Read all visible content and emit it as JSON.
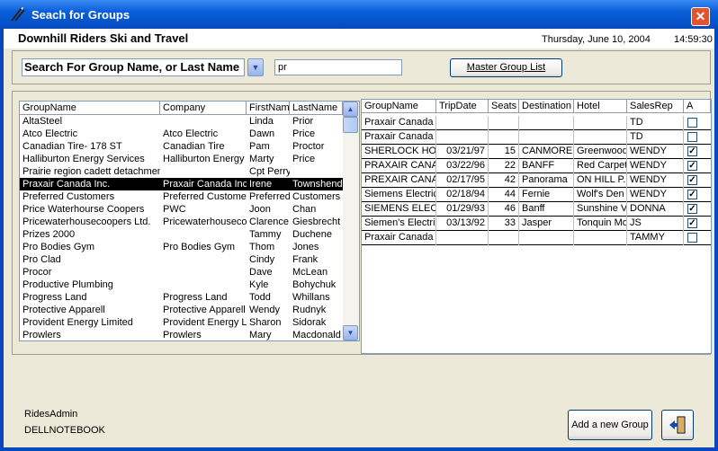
{
  "window": {
    "title": "Seach for Groups",
    "close_label": "✕"
  },
  "header": {
    "company": "Downhill Riders Ski and Travel",
    "date": "Thursday, June 10, 2004",
    "time": "14:59:30"
  },
  "search": {
    "field_label": "Search For Group Name, or Last Name",
    "value": "pr",
    "master_button": "Master Group List"
  },
  "left_grid": {
    "columns": [
      "GroupName",
      "Company",
      "FirstName",
      "LastName"
    ],
    "selected_index": 5,
    "rows": [
      [
        "AltaSteel",
        "",
        "Linda",
        "Prior"
      ],
      [
        "Atco Electric",
        "Atco Electric",
        "Dawn",
        "Price"
      ],
      [
        "Canadian Tire- 178 ST",
        "Canadian Tire",
        "Pam",
        "Proctor"
      ],
      [
        "Halliburton Energy Services",
        "Halliburton Energy S",
        "Marty",
        "Price"
      ],
      [
        "Prairie region cadett detachmen",
        "",
        "Cpt Perry",
        ""
      ],
      [
        "Praxair Canada Inc.",
        "Praxair Canada Inc",
        "Irene",
        "Townshend"
      ],
      [
        "Preferred Customers",
        "Preferred Customer",
        "Preferred",
        "Customers"
      ],
      [
        "Price Waterhourse Coopers",
        "PWC",
        "Joon",
        "Chan"
      ],
      [
        "Pricewaterhousecoopers Ltd.",
        "Pricewaterhouseco",
        "Clarence",
        "Giesbrecht"
      ],
      [
        "Prizes 2000",
        "",
        "Tammy",
        "Duchene"
      ],
      [
        "Pro Bodies Gym",
        "Pro Bodies Gym",
        "Thom",
        "Jones"
      ],
      [
        "Pro Clad",
        "",
        "Cindy",
        "Frank"
      ],
      [
        "Procor",
        "",
        "Dave",
        "McLean"
      ],
      [
        "Productive Plumbing",
        "",
        "Kyle",
        "Bohychuk"
      ],
      [
        "Progress Land",
        "Progress Land",
        "Todd",
        "Whillans"
      ],
      [
        "Protective Apparell",
        "Protective Apparell",
        "Wendy",
        "Rudnyk"
      ],
      [
        "Provident Energy Limited",
        "Provident Energy L",
        "Sharon",
        "Sidorak"
      ],
      [
        "Prowlers",
        "Prowlers",
        "Mary",
        "Macdonald"
      ]
    ]
  },
  "right_grid": {
    "columns": [
      "GroupName",
      "TripDate",
      "Seats",
      "Destination",
      "Hotel",
      "SalesRep",
      "A"
    ],
    "rows": [
      {
        "group": "Praxair Canada I",
        "date": "",
        "seats": "",
        "dest": "",
        "hotel": "",
        "rep": "TD",
        "active": false
      },
      {
        "group": "Praxair Canada I",
        "date": "",
        "seats": "",
        "dest": "",
        "hotel": "",
        "rep": "TD",
        "active": false
      },
      {
        "group": "SHERLOCK HO",
        "date": "03/21/97",
        "seats": "15",
        "dest": "CANMORE",
        "hotel": "Greenwood",
        "rep": "WENDY",
        "active": true
      },
      {
        "group": "PRAXAIR CANA",
        "date": "03/22/96",
        "seats": "22",
        "dest": "BANFF",
        "hotel": "Red Carpet",
        "rep": "WENDY",
        "active": true
      },
      {
        "group": "PREXAIR CANA",
        "date": "02/17/95",
        "seats": "42",
        "dest": "Panorama",
        "hotel": "ON HILL P.",
        "rep": "WENDY",
        "active": true
      },
      {
        "group": "Siemens Electric",
        "date": "02/18/94",
        "seats": "44",
        "dest": "Fernie",
        "hotel": "Wolf's Den",
        "rep": "WENDY",
        "active": true
      },
      {
        "group": "SIEMENS ELEC",
        "date": "01/29/93",
        "seats": "46",
        "dest": "Banff",
        "hotel": "Sunshine V",
        "rep": "DONNA",
        "active": true
      },
      {
        "group": "Siemen's Electric",
        "date": "03/13/92",
        "seats": "33",
        "dest": "Jasper",
        "hotel": "Tonquin Mo",
        "rep": "JS",
        "active": true
      },
      {
        "group": "Praxair Canada I",
        "date": "",
        "seats": "",
        "dest": "",
        "hotel": "",
        "rep": "TAMMY",
        "active": false
      }
    ]
  },
  "footer": {
    "user": "RidesAdmin",
    "machine": "DELLNOTEBOOK",
    "add_button": "Add a new Group"
  },
  "colors": {
    "titlebar": "#0a5fd8",
    "face": "#ece9d8",
    "close": "#e2532f"
  },
  "icons": {
    "app": "skis-icon",
    "exit": "exit-door-icon"
  }
}
